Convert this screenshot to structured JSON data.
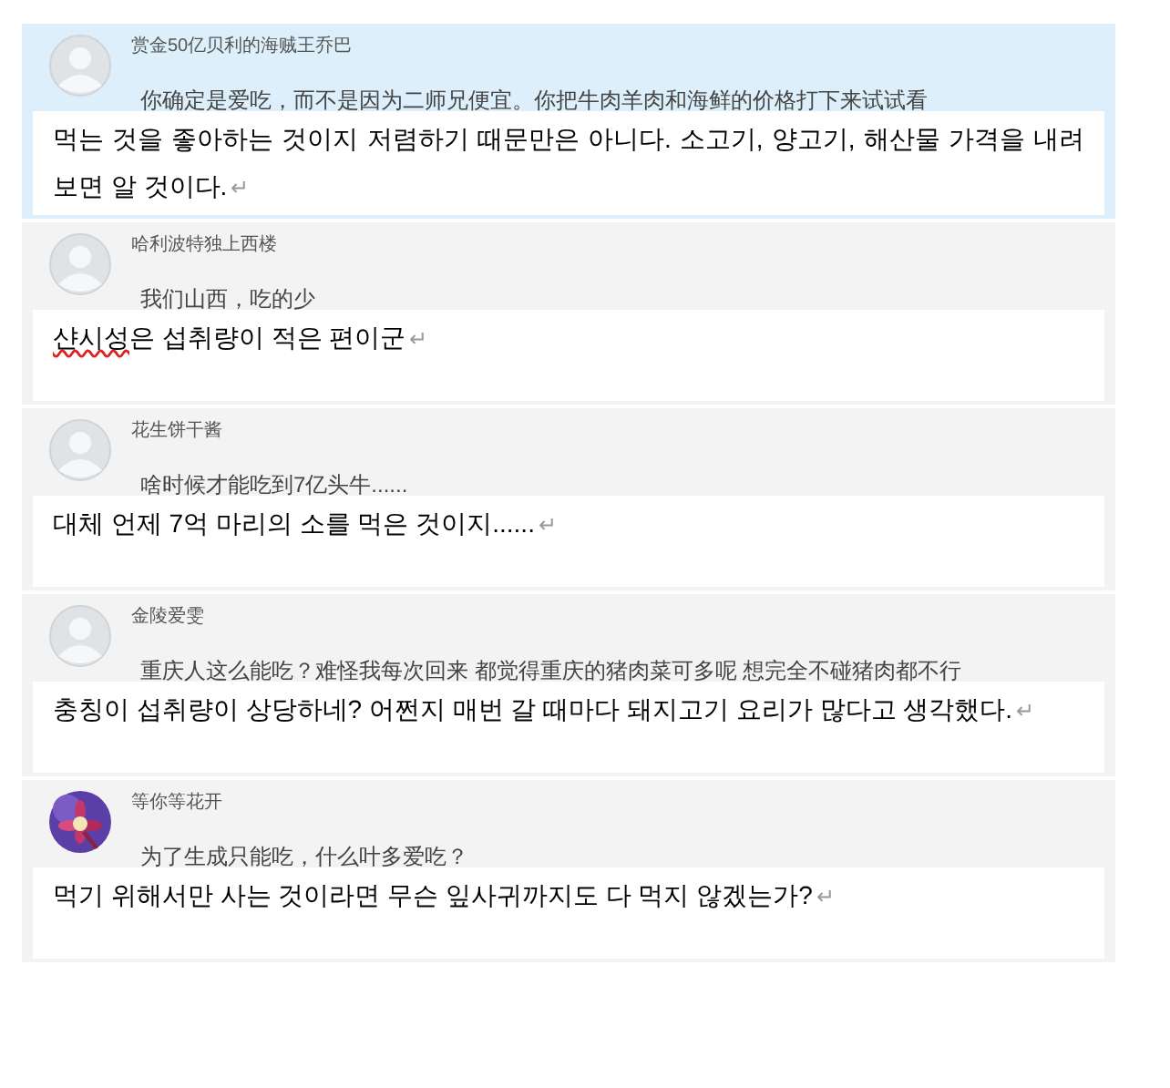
{
  "comments": [
    {
      "highlighted": true,
      "avatar": {
        "kind": "default"
      },
      "username": "赏金50亿贝利的海贼王乔巴",
      "text": "你确定是爱吃，而不是因为二师兄便宜。你把牛肉羊肉和海鲜的价格打下来试试看",
      "translation": {
        "text": "먹는 것을 좋아하는 것이지 저렴하기 때문만은 아니다. 소고기, 양고기, 해산물 가격을 내려보면 알 것이다.",
        "mark": "↵"
      }
    },
    {
      "highlighted": false,
      "avatar": {
        "kind": "default"
      },
      "username": "哈利波特独上西楼",
      "text": "我们山西，吃的少",
      "translation": {
        "flagged": "샨시성",
        "text": "은 섭취량이 적은 편이군",
        "mark": "↵"
      }
    },
    {
      "highlighted": false,
      "avatar": {
        "kind": "default"
      },
      "username": "花生饼干酱",
      "text": "啥时候才能吃到7亿头牛......",
      "translation": {
        "text": "대체 언제 7억 마리의 소를 먹은 것이지......",
        "mark": "↵"
      }
    },
    {
      "highlighted": false,
      "avatar": {
        "kind": "default"
      },
      "username": "金陵爱雯",
      "text": "重庆人这么能吃？难怪我每次回来 都觉得重庆的猪肉菜可多呢 想完全不碰猪肉都不行",
      "translation": {
        "text": "충칭이 섭취량이 상당하네? 어쩐지 매번 갈 때마다 돼지고기 요리가 많다고 생각했다.",
        "mark": "↵"
      }
    },
    {
      "highlighted": false,
      "username": "等你等花开",
      "text": "为了生成只能吃，什么叶多爱吃？",
      "translation": {
        "text": "먹기 위해서만 사는 것이라면 무슨 잎사귀까지도 다 먹지 않겠는가?",
        "mark": "↵"
      }
    }
  ]
}
